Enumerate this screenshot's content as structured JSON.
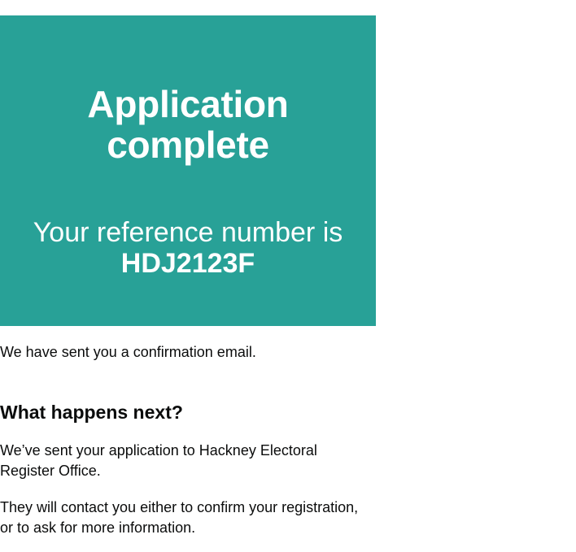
{
  "panel": {
    "title_line1": "Application",
    "title_line2": "complete",
    "reference_label": "Your reference number is",
    "reference_number": "HDJ2123F",
    "background_color": "#28a197"
  },
  "confirmation_text": "We have sent you a confirmation email.",
  "next_steps": {
    "heading": "What happens next?",
    "paragraph1_line1": "We’ve sent your application to Hackney Electoral",
    "paragraph1_line2": "Register Office.",
    "paragraph2_line1": "They will contact you either to confirm your registration,",
    "paragraph2_line2": "or to ask for more information."
  }
}
